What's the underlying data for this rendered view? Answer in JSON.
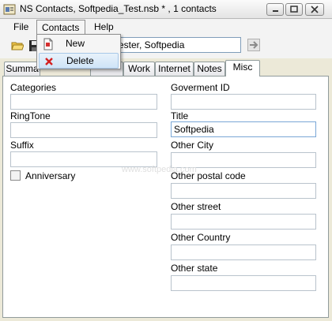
{
  "window": {
    "title": "NS Contacts, Softpedia_Test.nsb * , 1 contacts"
  },
  "menubar": {
    "items": [
      "File",
      "Contacts",
      "Help"
    ]
  },
  "contacts_menu": {
    "items": [
      "New",
      "Delete"
    ],
    "highlighted": "Delete"
  },
  "toolbar": {
    "contact_combo_value": "ester, Softpedia"
  },
  "tabs": [
    "Summa",
    "Work",
    "Internet",
    "Notes",
    "Misc"
  ],
  "active_tab": "Misc",
  "misc": {
    "categories_label": "Categories",
    "categories_value": "",
    "ringtone_label": "RingTone",
    "ringtone_value": "",
    "suffix_label": "Suffix",
    "suffix_value": "",
    "anniversary_label": "Anniversary",
    "anniversary_checked": false,
    "government_id_label": "Goverment ID",
    "government_id_value": "",
    "title_label": "Title",
    "title_value": "Softpedia",
    "other_city_label": "Other City",
    "other_city_value": "",
    "other_postal_code_label": "Other postal code",
    "other_postal_code_value": "",
    "other_street_label": "Other street",
    "other_street_value": "",
    "other_country_label": "Other Country",
    "other_country_value": "",
    "other_state_label": "Other state",
    "other_state_value": ""
  },
  "watermark": "www.softpedia.com",
  "colors": {
    "field_border": "#b9c3cc",
    "focus_border": "#7aa7d6",
    "menu_highlight": "#cfe4f7",
    "delete_red": "#d42020"
  }
}
